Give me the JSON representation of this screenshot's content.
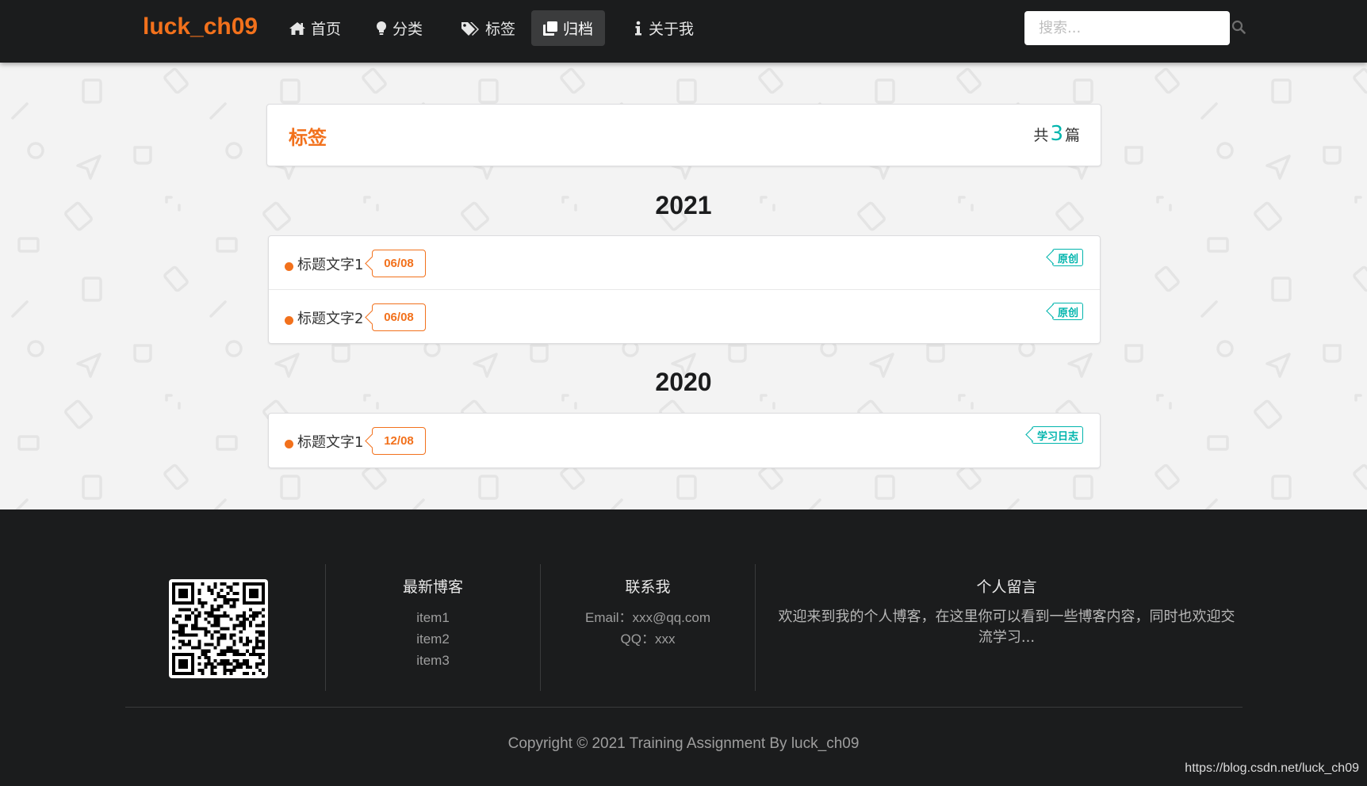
{
  "navbar": {
    "brand": "luck_ch09",
    "items": [
      {
        "label": "首页",
        "icon": "home-icon"
      },
      {
        "label": "分类",
        "icon": "lightbulb-icon"
      },
      {
        "label": "标签",
        "icon": "tags-icon"
      },
      {
        "label": "归档",
        "icon": "clone-icon",
        "active": true
      },
      {
        "label": "关于我",
        "icon": "info-icon"
      }
    ],
    "search": {
      "placeholder": "搜索...",
      "icon": "search-icon"
    }
  },
  "archive": {
    "title": "标签",
    "count_prefix": "共",
    "count": "3",
    "count_suffix": "篇",
    "years": [
      {
        "year": "2021",
        "posts": [
          {
            "title": "标题文字1",
            "date": "06/08",
            "type": "原创"
          },
          {
            "title": "标题文字2",
            "date": "06/08",
            "type": "原创"
          }
        ]
      },
      {
        "year": "2020",
        "posts": [
          {
            "title": "标题文字1",
            "date": "12/08",
            "type": "学习日志"
          }
        ]
      }
    ]
  },
  "footer": {
    "latest": {
      "heading": "最新博客",
      "items": [
        "item1",
        "item2",
        "item3"
      ]
    },
    "contact": {
      "heading": "联系我",
      "email": "Email：xxx@qq.com",
      "qq": "QQ：xxx"
    },
    "message": {
      "heading": "个人留言",
      "text": "欢迎来到我的个人博客，在这里你可以看到一些博客内容，同时也欢迎交流学习..."
    },
    "copyright": "Copyright © 2021 Training Assignment By luck_ch09",
    "watermark": "https://blog.csdn.net/luck_ch09"
  },
  "colors": {
    "accent_orange": "#f2711c",
    "accent_teal": "#00b5ad",
    "dark": "#1b1c1d",
    "page_bg": "#f3f3f3"
  }
}
